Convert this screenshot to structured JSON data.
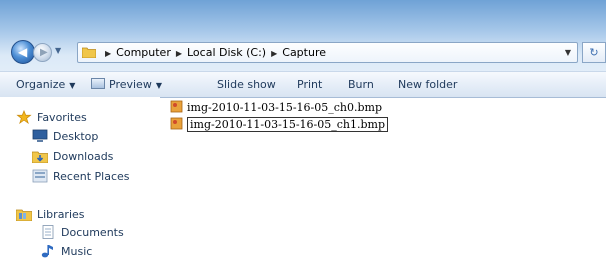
{
  "address_bar": {
    "breadcrumbs": [
      "Computer",
      "Local Disk (C:)",
      "Capture"
    ]
  },
  "toolbar": {
    "organize": "Organize",
    "preview": "Preview",
    "slide_show": "Slide show",
    "print": "Print",
    "burn": "Burn",
    "new_folder": "New folder"
  },
  "sidebar": {
    "favorites": {
      "label": "Favorites",
      "items": [
        "Desktop",
        "Downloads",
        "Recent Places"
      ]
    },
    "libraries": {
      "label": "Libraries",
      "items": [
        "Documents",
        "Music"
      ]
    }
  },
  "files": [
    {
      "name": "img-2010-11-03-15-16-05_ch0.bmp",
      "selected": false
    },
    {
      "name": "img-2010-11-03-15-16-05_ch1.bmp",
      "selected": true
    }
  ],
  "colors": {
    "title_gradient_top": "#6fa2d6",
    "text": "#1e395b",
    "favorites_star": "#f2b51c",
    "folder_yellow": "#f0c64a"
  }
}
